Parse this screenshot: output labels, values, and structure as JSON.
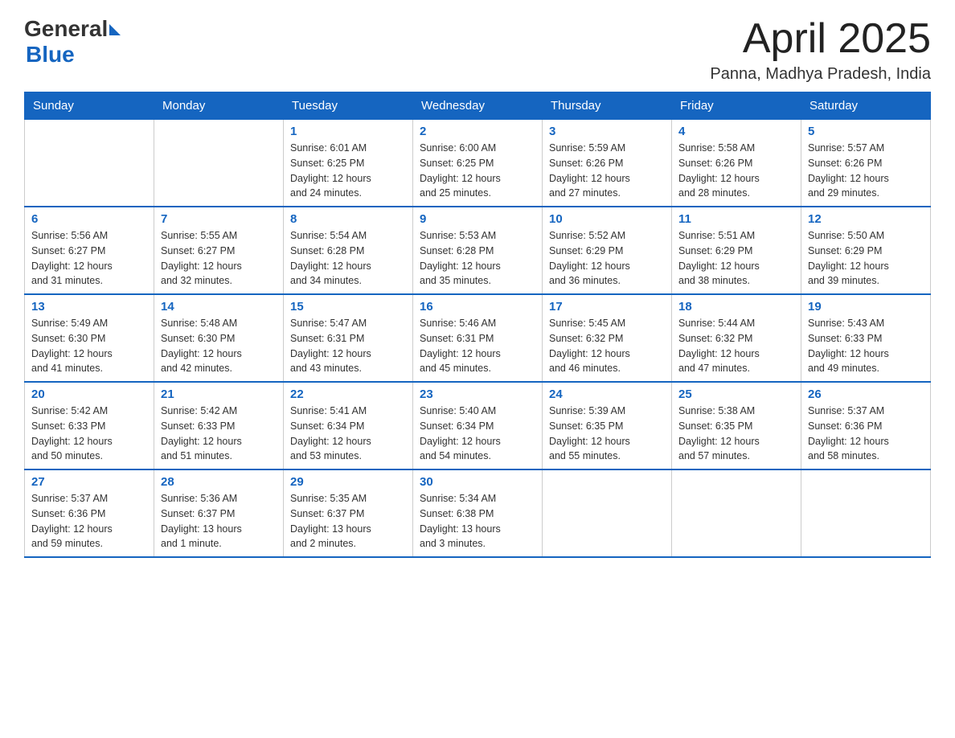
{
  "header": {
    "logo_general": "General",
    "logo_blue": "Blue",
    "month_title": "April 2025",
    "location": "Panna, Madhya Pradesh, India"
  },
  "weekdays": [
    "Sunday",
    "Monday",
    "Tuesday",
    "Wednesday",
    "Thursday",
    "Friday",
    "Saturday"
  ],
  "weeks": [
    [
      {
        "day": "",
        "info": ""
      },
      {
        "day": "",
        "info": ""
      },
      {
        "day": "1",
        "info": "Sunrise: 6:01 AM\nSunset: 6:25 PM\nDaylight: 12 hours\nand 24 minutes."
      },
      {
        "day": "2",
        "info": "Sunrise: 6:00 AM\nSunset: 6:25 PM\nDaylight: 12 hours\nand 25 minutes."
      },
      {
        "day": "3",
        "info": "Sunrise: 5:59 AM\nSunset: 6:26 PM\nDaylight: 12 hours\nand 27 minutes."
      },
      {
        "day": "4",
        "info": "Sunrise: 5:58 AM\nSunset: 6:26 PM\nDaylight: 12 hours\nand 28 minutes."
      },
      {
        "day": "5",
        "info": "Sunrise: 5:57 AM\nSunset: 6:26 PM\nDaylight: 12 hours\nand 29 minutes."
      }
    ],
    [
      {
        "day": "6",
        "info": "Sunrise: 5:56 AM\nSunset: 6:27 PM\nDaylight: 12 hours\nand 31 minutes."
      },
      {
        "day": "7",
        "info": "Sunrise: 5:55 AM\nSunset: 6:27 PM\nDaylight: 12 hours\nand 32 minutes."
      },
      {
        "day": "8",
        "info": "Sunrise: 5:54 AM\nSunset: 6:28 PM\nDaylight: 12 hours\nand 34 minutes."
      },
      {
        "day": "9",
        "info": "Sunrise: 5:53 AM\nSunset: 6:28 PM\nDaylight: 12 hours\nand 35 minutes."
      },
      {
        "day": "10",
        "info": "Sunrise: 5:52 AM\nSunset: 6:29 PM\nDaylight: 12 hours\nand 36 minutes."
      },
      {
        "day": "11",
        "info": "Sunrise: 5:51 AM\nSunset: 6:29 PM\nDaylight: 12 hours\nand 38 minutes."
      },
      {
        "day": "12",
        "info": "Sunrise: 5:50 AM\nSunset: 6:29 PM\nDaylight: 12 hours\nand 39 minutes."
      }
    ],
    [
      {
        "day": "13",
        "info": "Sunrise: 5:49 AM\nSunset: 6:30 PM\nDaylight: 12 hours\nand 41 minutes."
      },
      {
        "day": "14",
        "info": "Sunrise: 5:48 AM\nSunset: 6:30 PM\nDaylight: 12 hours\nand 42 minutes."
      },
      {
        "day": "15",
        "info": "Sunrise: 5:47 AM\nSunset: 6:31 PM\nDaylight: 12 hours\nand 43 minutes."
      },
      {
        "day": "16",
        "info": "Sunrise: 5:46 AM\nSunset: 6:31 PM\nDaylight: 12 hours\nand 45 minutes."
      },
      {
        "day": "17",
        "info": "Sunrise: 5:45 AM\nSunset: 6:32 PM\nDaylight: 12 hours\nand 46 minutes."
      },
      {
        "day": "18",
        "info": "Sunrise: 5:44 AM\nSunset: 6:32 PM\nDaylight: 12 hours\nand 47 minutes."
      },
      {
        "day": "19",
        "info": "Sunrise: 5:43 AM\nSunset: 6:33 PM\nDaylight: 12 hours\nand 49 minutes."
      }
    ],
    [
      {
        "day": "20",
        "info": "Sunrise: 5:42 AM\nSunset: 6:33 PM\nDaylight: 12 hours\nand 50 minutes."
      },
      {
        "day": "21",
        "info": "Sunrise: 5:42 AM\nSunset: 6:33 PM\nDaylight: 12 hours\nand 51 minutes."
      },
      {
        "day": "22",
        "info": "Sunrise: 5:41 AM\nSunset: 6:34 PM\nDaylight: 12 hours\nand 53 minutes."
      },
      {
        "day": "23",
        "info": "Sunrise: 5:40 AM\nSunset: 6:34 PM\nDaylight: 12 hours\nand 54 minutes."
      },
      {
        "day": "24",
        "info": "Sunrise: 5:39 AM\nSunset: 6:35 PM\nDaylight: 12 hours\nand 55 minutes."
      },
      {
        "day": "25",
        "info": "Sunrise: 5:38 AM\nSunset: 6:35 PM\nDaylight: 12 hours\nand 57 minutes."
      },
      {
        "day": "26",
        "info": "Sunrise: 5:37 AM\nSunset: 6:36 PM\nDaylight: 12 hours\nand 58 minutes."
      }
    ],
    [
      {
        "day": "27",
        "info": "Sunrise: 5:37 AM\nSunset: 6:36 PM\nDaylight: 12 hours\nand 59 minutes."
      },
      {
        "day": "28",
        "info": "Sunrise: 5:36 AM\nSunset: 6:37 PM\nDaylight: 13 hours\nand 1 minute."
      },
      {
        "day": "29",
        "info": "Sunrise: 5:35 AM\nSunset: 6:37 PM\nDaylight: 13 hours\nand 2 minutes."
      },
      {
        "day": "30",
        "info": "Sunrise: 5:34 AM\nSunset: 6:38 PM\nDaylight: 13 hours\nand 3 minutes."
      },
      {
        "day": "",
        "info": ""
      },
      {
        "day": "",
        "info": ""
      },
      {
        "day": "",
        "info": ""
      }
    ]
  ]
}
